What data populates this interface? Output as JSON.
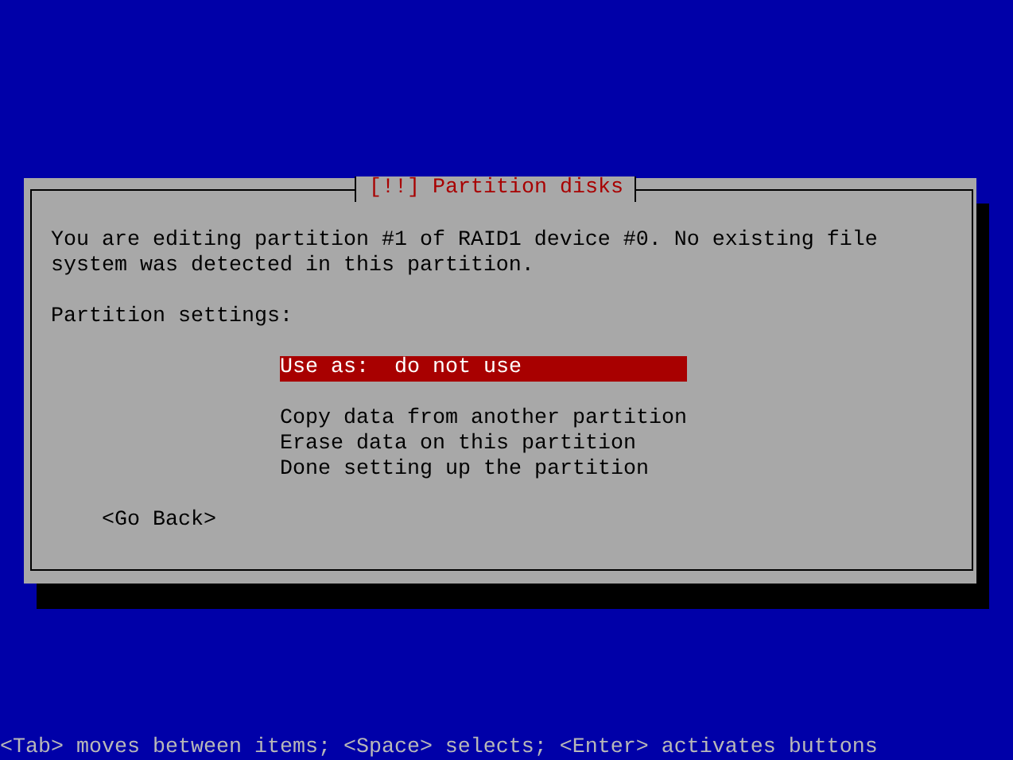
{
  "dialog": {
    "title": "[!!] Partition disks",
    "message": [
      "You are editing partition #1 of RAID1 device #0. No existing file",
      "system was detected in this partition."
    ],
    "settings_label": "Partition settings:",
    "menu_groups": [
      [
        {
          "label": "Use as:  do not use",
          "selected": true
        }
      ],
      [
        {
          "label": "Copy data from another partition",
          "selected": false
        },
        {
          "label": "Erase data on this partition",
          "selected": false
        },
        {
          "label": "Done setting up the partition",
          "selected": false
        }
      ]
    ],
    "back_button": "<Go Back>"
  },
  "help_line": "<Tab> moves between items; <Space> selects; <Enter> activates buttons"
}
